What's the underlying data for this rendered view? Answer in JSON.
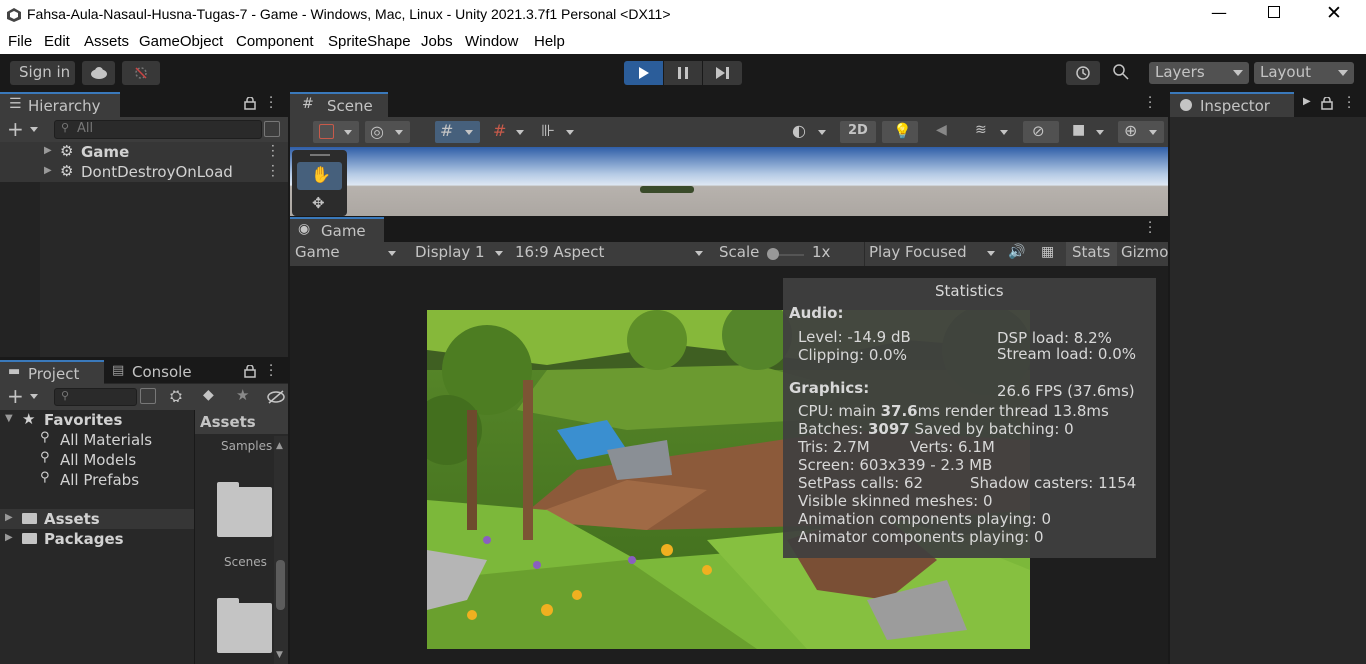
{
  "window": {
    "title": "Fahsa-Aula-Nasaul-Husna-Tugas-7 - Game - Windows, Mac, Linux - Unity 2021.3.7f1 Personal <DX11>"
  },
  "menu": [
    "File",
    "Edit",
    "Assets",
    "GameObject",
    "Component",
    "SpriteShape",
    "Jobs",
    "Window",
    "Help"
  ],
  "toolbar": {
    "sign_in": "Sign in",
    "layers": "Layers",
    "layout": "Layout"
  },
  "hierarchy": {
    "tab": "Hierarchy",
    "search_placeholder": "All",
    "items": [
      "Game",
      "DontDestroyOnLoad"
    ]
  },
  "scene": {
    "tab": "Scene",
    "mode_2d": "2D"
  },
  "game": {
    "tab": "Game",
    "display_mode": "Game",
    "display": "Display 1",
    "aspect": "16:9 Aspect",
    "scale_label": "Scale",
    "scale_value": "1x",
    "play_focused": "Play Focused",
    "stats": "Stats",
    "gizmos": "Gizmo"
  },
  "inspector": {
    "tab": "Inspector"
  },
  "project": {
    "tab_project": "Project",
    "tab_console": "Console",
    "favorites_label": "Favorites",
    "favorites": [
      "All Materials",
      "All Models",
      "All Prefabs"
    ],
    "roots": [
      "Assets",
      "Packages"
    ],
    "assets_header": "Assets",
    "folder_samples": "Samples",
    "folder_scenes": "Scenes"
  },
  "statistics": {
    "title": "Statistics",
    "audio_header": "Audio:",
    "level": "Level: -14.9 dB",
    "clipping": "Clipping: 0.0%",
    "dsp": "DSP load: 8.2%",
    "stream": "Stream load: 0.0%",
    "graphics_header": "Graphics:",
    "fps": "26.6 FPS (37.6ms)",
    "cpu_prefix": "CPU: main ",
    "cpu_main": "37.6",
    "cpu_suffix": "ms  render thread 13.8ms",
    "batches_prefix": "Batches: ",
    "batches": "3097",
    "batches_suffix": "  Saved by batching: 0",
    "tris": "Tris: 2.7M",
    "verts": "Verts: 6.1M",
    "screen": "Screen: 603x339 - 2.3 MB",
    "setpass": "SetPass calls: 62",
    "shadow": "Shadow casters: 1154",
    "skinned": "Visible skinned meshes: 0",
    "animation": "Animation components playing: 0",
    "animator": "Animator components playing: 0"
  },
  "colors": {
    "accent": "#3a79bb",
    "panel": "#282828",
    "dark": "#191919"
  }
}
